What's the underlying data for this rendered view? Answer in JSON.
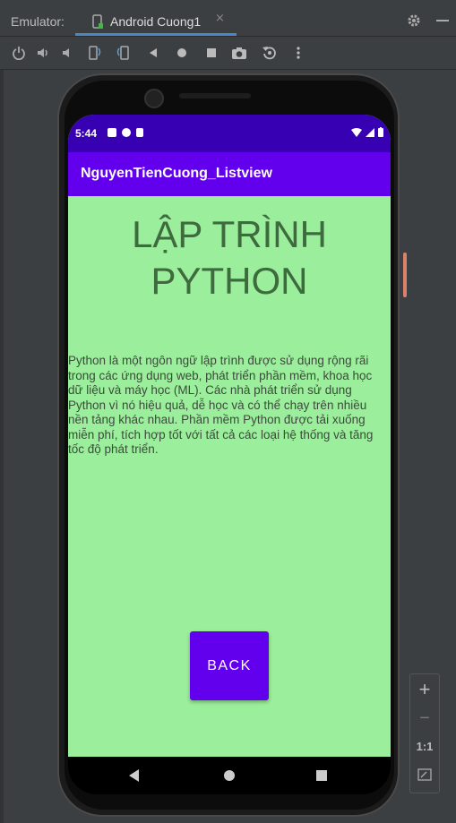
{
  "emulator": {
    "label": "Emulator:",
    "tab_title": "Android Cuong1",
    "tab_close": "×",
    "toolbar": [
      "power-icon",
      "volume-up-icon",
      "volume-down-icon",
      "rotate-left-icon",
      "rotate-right-icon",
      "back-icon",
      "home-icon",
      "overview-icon",
      "camera-icon",
      "replay-icon",
      "more-icon"
    ]
  },
  "status_bar": {
    "time": "5:44"
  },
  "app": {
    "title": "NguyenTienCuong_Listview",
    "heading_line1": "LẬP TRÌNH",
    "heading_line2": "PYTHON",
    "paragraph": "Python là một ngôn ngữ lập trình được sử dụng rộng rãi trong các ứng dụng web, phát triển phần mềm, khoa học dữ liệu và máy học (ML). Các nhà phát triển sử dụng Python vì nó hiệu quả, dễ học và có thể chạy trên nhiều nền tảng khác nhau. Phần mềm Python được tải xuống miễn phí, tích hợp tốt với tất cả các loại hệ thống và tăng tốc độ phát triển.",
    "back_label": "BACK"
  },
  "zoom": {
    "plus": "+",
    "minus": "−",
    "ratio": "1:1"
  },
  "colors": {
    "status_bar": "#3700b3",
    "app_bar": "#6200ee",
    "background": "#9bee9b"
  }
}
